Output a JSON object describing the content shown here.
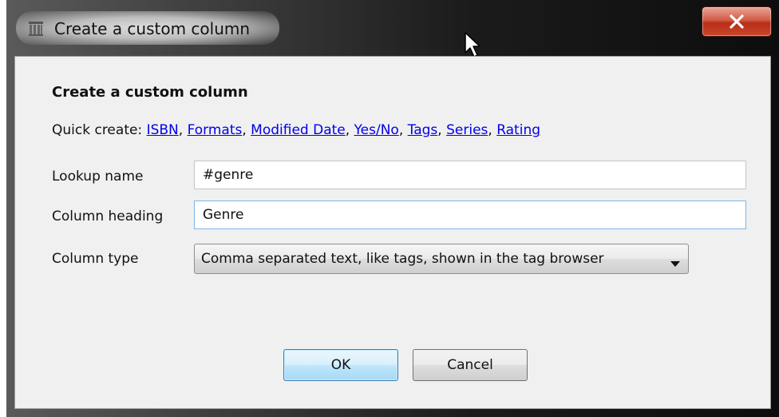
{
  "window": {
    "title": "Create a custom column"
  },
  "dialog": {
    "heading": "Create a custom column",
    "quick_create": {
      "label": "Quick create:",
      "links": [
        "ISBN",
        "Formats",
        "Modified Date",
        "Yes/No",
        "Tags",
        "Series",
        "Rating"
      ]
    },
    "fields": {
      "lookup_name": {
        "label": "Lookup name",
        "value": "#genre"
      },
      "column_heading": {
        "label": "Column heading",
        "value": "Genre"
      },
      "column_type": {
        "label": "Column type",
        "selected": "Comma separated text, like tags, shown in the tag browser"
      }
    },
    "buttons": {
      "ok": "OK",
      "cancel": "Cancel"
    }
  },
  "colors": {
    "link": "#0000ee",
    "close_button": "#c8482c",
    "ok_border": "#3c7fb1",
    "focus_border": "#7eb4ea"
  },
  "icons": [
    "app-icon",
    "close-icon",
    "mouse-cursor-icon",
    "dropdown-arrow-icon"
  ]
}
